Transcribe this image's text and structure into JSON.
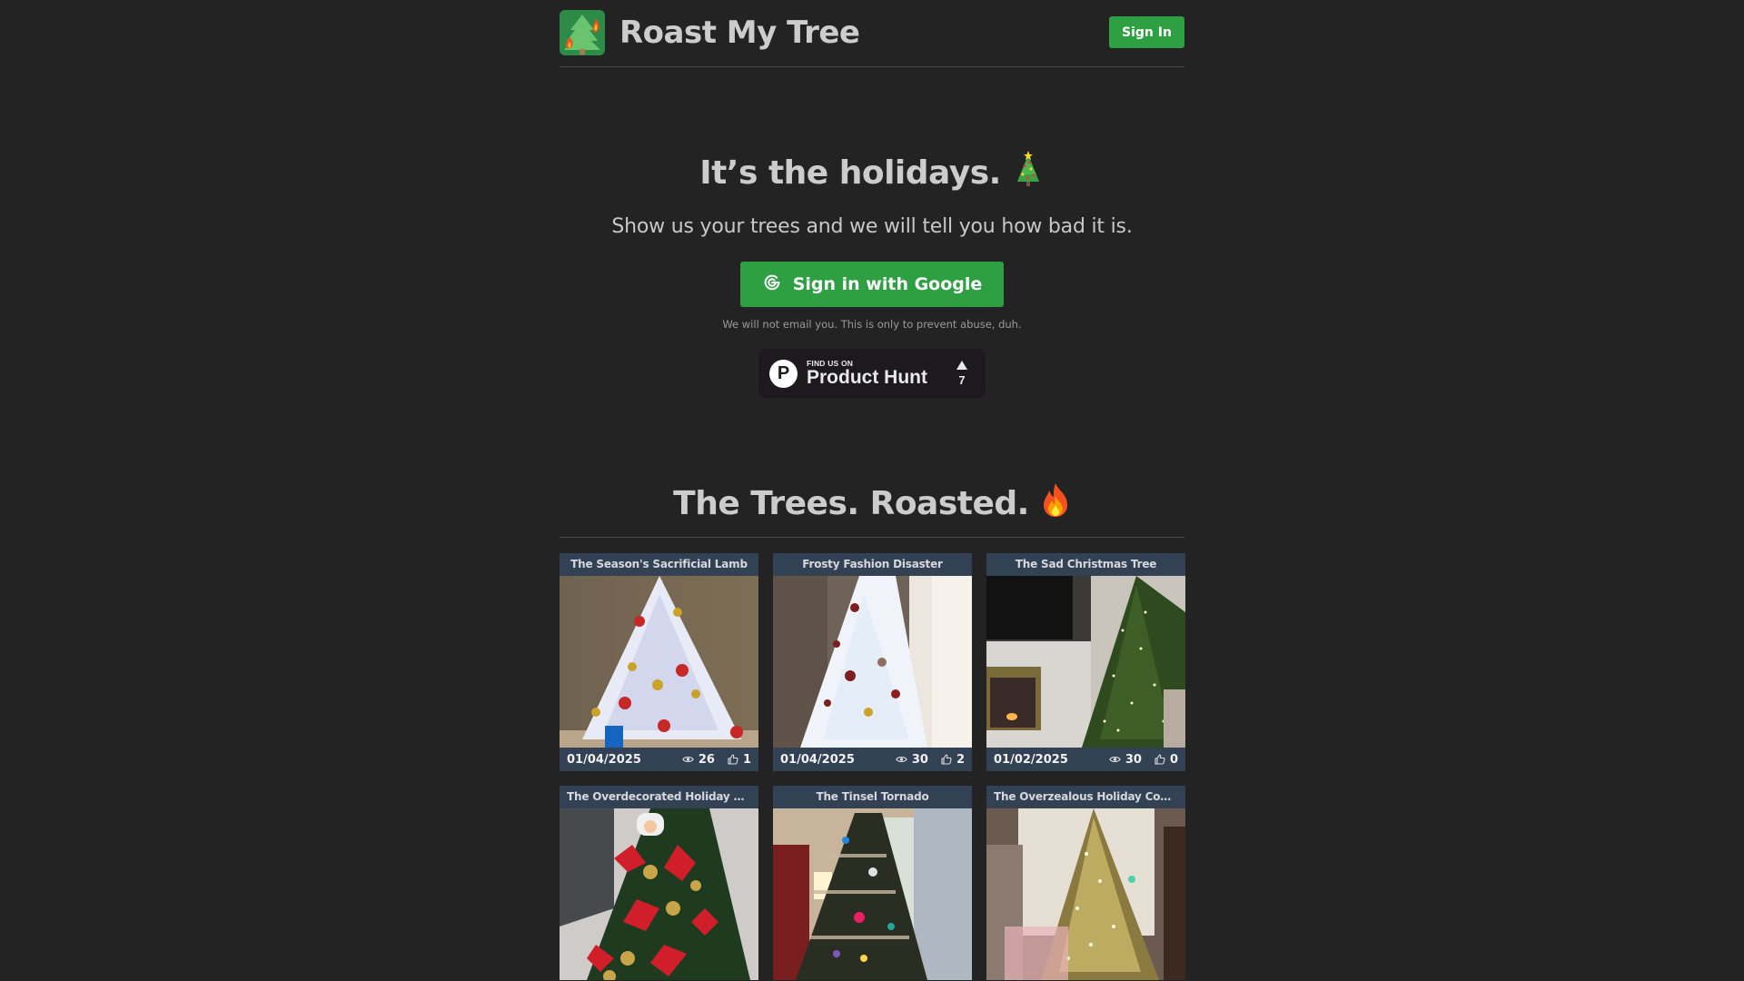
{
  "header": {
    "brand_title": "Roast My Tree",
    "logo_icon": "burning-tree-icon",
    "sign_in_label": "Sign In"
  },
  "hero": {
    "title": "It’s the holidays.",
    "title_emoji": "🎄",
    "subtitle": "Show us your trees and we will tell you how bad it is.",
    "google_button_label": "Sign in with Google",
    "google_icon": "google-g-icon",
    "note": "We will not email you. This is only to prevent abuse, duh."
  },
  "product_hunt": {
    "small_label": "FIND US ON",
    "big_label": "Product Hunt",
    "logo_letter": "P",
    "upvote_count": "7"
  },
  "gallery": {
    "title": "The Trees. Roasted.",
    "title_emoji": "🔥",
    "cards": [
      {
        "title": "The Season's Sacrificial Lamb",
        "date": "01/04/2025",
        "views": "26",
        "likes": "1",
        "image": "white-tree-gold-red-ornaments"
      },
      {
        "title": "Frosty Fashion Disaster",
        "date": "01/04/2025",
        "views": "30",
        "likes": "2",
        "image": "white-tree-by-curtain"
      },
      {
        "title": "The Sad Christmas Tree",
        "date": "01/02/2025",
        "views": "30",
        "likes": "0",
        "image": "green-tree-by-fireplace"
      },
      {
        "title": "The Overdecorated Holiday Disa...",
        "date": "",
        "views": "",
        "likes": "",
        "image": "red-poinsettia-tree"
      },
      {
        "title": "The Tinsel Tornado",
        "date": "",
        "views": "",
        "likes": "",
        "image": "tinsel-tree-by-window"
      },
      {
        "title": "The Overzealous Holiday Cousin...",
        "date": "",
        "views": "",
        "likes": "",
        "image": "gold-tree-with-village"
      }
    ]
  },
  "colors": {
    "background": "#232323",
    "accent_green": "#2ea043",
    "card_bg": "#334155",
    "text": "#cccccc"
  }
}
